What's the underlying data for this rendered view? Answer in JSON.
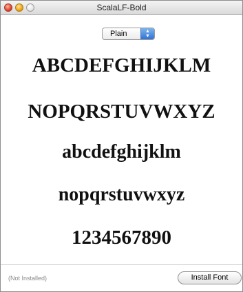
{
  "window": {
    "title": "ScalaLF-Bold"
  },
  "style_select": {
    "value": "Plain",
    "arrows_up": "▲",
    "arrows_down": "▼"
  },
  "samples": {
    "uppercase_1": "ABCDEFGHIJKLM",
    "uppercase_2": "NOPQRSTUVWXYZ",
    "lowercase_1": "abcdefghijklm",
    "lowercase_2": "nopqrstuvwxyz",
    "digits": "1234567890"
  },
  "footer": {
    "status": "(Not Installed)",
    "install_label": "Install Font"
  }
}
